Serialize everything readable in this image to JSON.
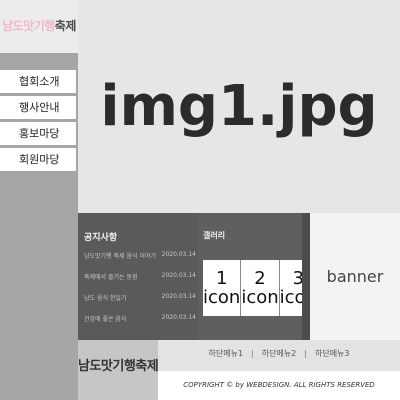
{
  "logo": {
    "part1": "남도맛기행",
    "part2": "축제"
  },
  "nav": {
    "items": [
      {
        "label": "협회소개"
      },
      {
        "label": "행사안내"
      },
      {
        "label": "홍보마당"
      },
      {
        "label": "회원마당"
      }
    ]
  },
  "hero": {
    "image_label": "img1.jpg"
  },
  "notice": {
    "title": "공지사항",
    "items": [
      {
        "title": "남도맛기행 축제 음식 이야기",
        "date": "2020.03.14"
      },
      {
        "title": "축제에서 즐기는 동정",
        "date": "2020.03.14"
      },
      {
        "title": "남도 음식 한일기",
        "date": "2020.03.14"
      },
      {
        "title": "건강에 좋은 음식",
        "date": "2020.03.14"
      }
    ]
  },
  "gallery": {
    "title": "갤러리",
    "icons": [
      {
        "number": "1",
        "label": "icon"
      },
      {
        "number": "2",
        "label": "icon"
      },
      {
        "number": "3",
        "label": "icon"
      }
    ]
  },
  "banner": {
    "label": "banner"
  },
  "footer": {
    "logo": "남도맛기행축제",
    "menu": [
      {
        "label": "하단메뉴1"
      },
      {
        "label": "하단메뉴2"
      },
      {
        "label": "하단메뉴3"
      }
    ],
    "separator": "|",
    "copyright": "COPYRIGHT © by WEBDESIGN. ALL RIGHTS RESERVED"
  },
  "colors": {
    "logo_accent": "#f2b8c6",
    "sidebar": "#a6a6a6",
    "hero_bg": "#e6e6e6",
    "notice_bg": "#5a5a5a",
    "gallery_bg": "#5f5f5f"
  }
}
